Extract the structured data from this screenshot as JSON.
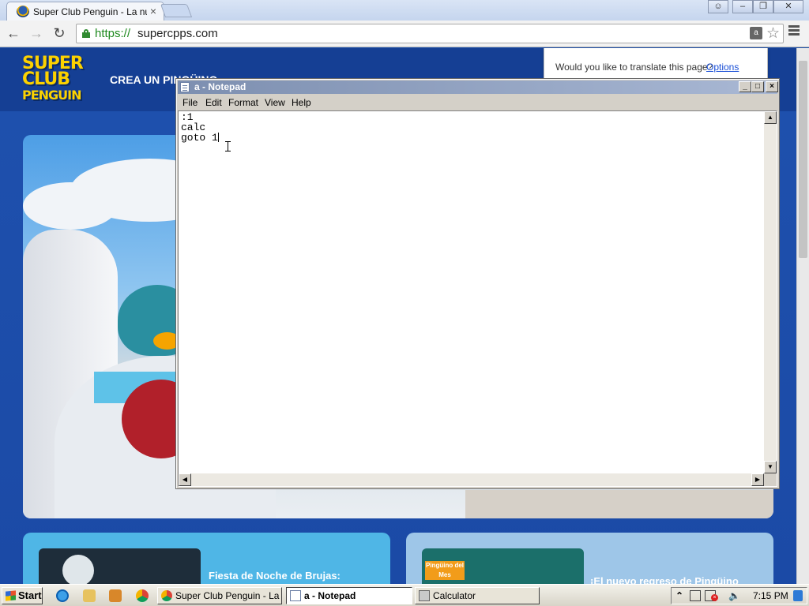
{
  "browser": {
    "tab_title": "Super Club Penguin - La nueva aventura",
    "tab_close": "×",
    "url_scheme": "https://",
    "url_host": "supercpps.com",
    "translate_prompt": "Would you like to translate this page?",
    "translate_options": "Options"
  },
  "site": {
    "logo_line1": "SUPER",
    "logo_line2": "CLUB",
    "logo_line3": "PENGUIN",
    "nav_item": "CREA UN PINGÜINO",
    "card_left_title": "Fiesta de Noche de Brujas:",
    "card_right_title": "¡El nuevo regreso de Pingüino",
    "card_right_badge": "Pingüino del Mes"
  },
  "notepad": {
    "title": "a - Notepad",
    "menus": [
      "File",
      "Edit",
      "Format",
      "View",
      "Help"
    ],
    "content": ":1\ncalc\ngoto 1"
  },
  "taskbar": {
    "start_label": "Start",
    "tasks": [
      {
        "label": "Super Club Penguin - La ..."
      },
      {
        "label": "a - Notepad"
      },
      {
        "label": "Calculator"
      }
    ],
    "clock": "7:15 PM"
  },
  "colors": {
    "page_bg": "#1d4fa8",
    "logo_yellow": "#fcd200",
    "url_green": "#1f8a1f",
    "notepad_title_bar": "#7d8fb0"
  }
}
